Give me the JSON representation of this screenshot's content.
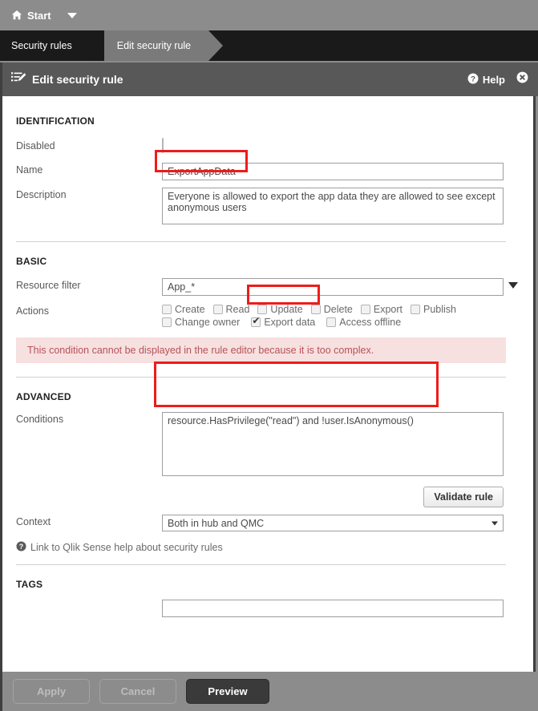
{
  "topbar": {
    "start_label": "Start",
    "home_icon": "home-icon",
    "caret_icon": "chevron-down-icon"
  },
  "breadcrumb": {
    "items": [
      {
        "label": "Security rules",
        "active": false
      },
      {
        "label": "Edit security rule",
        "active": true
      }
    ]
  },
  "panel_header": {
    "icon": "edit-list-icon",
    "title": "Edit security rule",
    "help_label": "Help",
    "help_icon": "question-circle-icon",
    "close_icon": "close-circle-icon"
  },
  "identification": {
    "section_title": "IDENTIFICATION",
    "disabled_label": "Disabled",
    "disabled_checked": false,
    "name_label": "Name",
    "name_value": "ExportAppData",
    "name_placeholder": "",
    "description_label": "Description",
    "description_value": "Everyone is allowed to export the app data they are allowed to see except anonymous users",
    "description_placeholder": ""
  },
  "basic": {
    "section_title": "BASIC",
    "resource_filter_label": "Resource filter",
    "resource_filter_value": "App_*",
    "resource_filter_placeholder": "",
    "actions_label": "Actions",
    "actions_row1": [
      {
        "label": "Create",
        "checked": false
      },
      {
        "label": "Read",
        "checked": false
      },
      {
        "label": "Update",
        "checked": false
      },
      {
        "label": "Delete",
        "checked": false
      },
      {
        "label": "Export",
        "checked": false
      },
      {
        "label": "Publish",
        "checked": false
      }
    ],
    "actions_row2": [
      {
        "label": "Change owner",
        "checked": false
      },
      {
        "label": "Export data",
        "checked": true
      },
      {
        "label": "Access offline",
        "checked": false
      }
    ],
    "warning_text": "This condition cannot be displayed in the rule editor because it is too complex."
  },
  "advanced": {
    "section_title": "ADVANCED",
    "conditions_label": "Conditions",
    "conditions_value": "resource.HasPrivilege(\"read\") and !user.IsAnonymous()",
    "conditions_placeholder": "",
    "validate_button": "Validate rule",
    "context_label": "Context",
    "context_value": "Both in hub and QMC",
    "help_link_text": "Link to Qlik Sense help about security rules",
    "help_link_icon": "question-circle-icon"
  },
  "tags": {
    "section_title": "TAGS",
    "value": "",
    "placeholder": ""
  },
  "footer": {
    "apply_label": "Apply",
    "cancel_label": "Cancel",
    "preview_label": "Preview"
  },
  "colors": {
    "topbar": "#8c8c8c",
    "crumbbar": "#1a1a1a",
    "crumb_active": "#7a7a7a",
    "panel_header": "#585858",
    "warning_bg": "#f7e0e0",
    "warning_text": "#b5535a",
    "annotation": "#ef1b1b",
    "preview_button": "#3a3a3a"
  }
}
